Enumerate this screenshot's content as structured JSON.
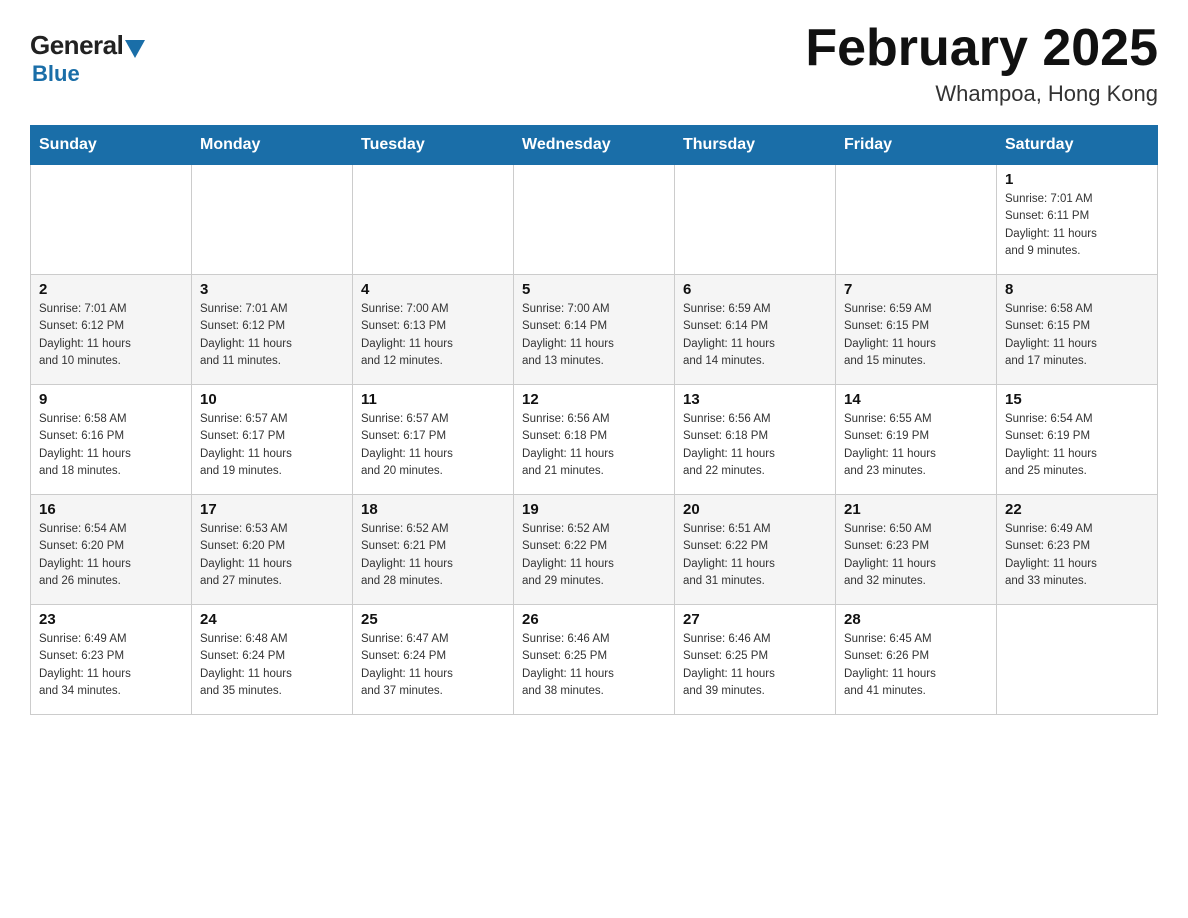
{
  "header": {
    "logo_general": "General",
    "logo_blue": "Blue",
    "month_title": "February 2025",
    "location": "Whampoa, Hong Kong"
  },
  "calendar": {
    "days": [
      "Sunday",
      "Monday",
      "Tuesday",
      "Wednesday",
      "Thursday",
      "Friday",
      "Saturday"
    ],
    "weeks": [
      [
        {
          "day": "",
          "info": ""
        },
        {
          "day": "",
          "info": ""
        },
        {
          "day": "",
          "info": ""
        },
        {
          "day": "",
          "info": ""
        },
        {
          "day": "",
          "info": ""
        },
        {
          "day": "",
          "info": ""
        },
        {
          "day": "1",
          "info": "Sunrise: 7:01 AM\nSunset: 6:11 PM\nDaylight: 11 hours\nand 9 minutes."
        }
      ],
      [
        {
          "day": "2",
          "info": "Sunrise: 7:01 AM\nSunset: 6:12 PM\nDaylight: 11 hours\nand 10 minutes."
        },
        {
          "day": "3",
          "info": "Sunrise: 7:01 AM\nSunset: 6:12 PM\nDaylight: 11 hours\nand 11 minutes."
        },
        {
          "day": "4",
          "info": "Sunrise: 7:00 AM\nSunset: 6:13 PM\nDaylight: 11 hours\nand 12 minutes."
        },
        {
          "day": "5",
          "info": "Sunrise: 7:00 AM\nSunset: 6:14 PM\nDaylight: 11 hours\nand 13 minutes."
        },
        {
          "day": "6",
          "info": "Sunrise: 6:59 AM\nSunset: 6:14 PM\nDaylight: 11 hours\nand 14 minutes."
        },
        {
          "day": "7",
          "info": "Sunrise: 6:59 AM\nSunset: 6:15 PM\nDaylight: 11 hours\nand 15 minutes."
        },
        {
          "day": "8",
          "info": "Sunrise: 6:58 AM\nSunset: 6:15 PM\nDaylight: 11 hours\nand 17 minutes."
        }
      ],
      [
        {
          "day": "9",
          "info": "Sunrise: 6:58 AM\nSunset: 6:16 PM\nDaylight: 11 hours\nand 18 minutes."
        },
        {
          "day": "10",
          "info": "Sunrise: 6:57 AM\nSunset: 6:17 PM\nDaylight: 11 hours\nand 19 minutes."
        },
        {
          "day": "11",
          "info": "Sunrise: 6:57 AM\nSunset: 6:17 PM\nDaylight: 11 hours\nand 20 minutes."
        },
        {
          "day": "12",
          "info": "Sunrise: 6:56 AM\nSunset: 6:18 PM\nDaylight: 11 hours\nand 21 minutes."
        },
        {
          "day": "13",
          "info": "Sunrise: 6:56 AM\nSunset: 6:18 PM\nDaylight: 11 hours\nand 22 minutes."
        },
        {
          "day": "14",
          "info": "Sunrise: 6:55 AM\nSunset: 6:19 PM\nDaylight: 11 hours\nand 23 minutes."
        },
        {
          "day": "15",
          "info": "Sunrise: 6:54 AM\nSunset: 6:19 PM\nDaylight: 11 hours\nand 25 minutes."
        }
      ],
      [
        {
          "day": "16",
          "info": "Sunrise: 6:54 AM\nSunset: 6:20 PM\nDaylight: 11 hours\nand 26 minutes."
        },
        {
          "day": "17",
          "info": "Sunrise: 6:53 AM\nSunset: 6:20 PM\nDaylight: 11 hours\nand 27 minutes."
        },
        {
          "day": "18",
          "info": "Sunrise: 6:52 AM\nSunset: 6:21 PM\nDaylight: 11 hours\nand 28 minutes."
        },
        {
          "day": "19",
          "info": "Sunrise: 6:52 AM\nSunset: 6:22 PM\nDaylight: 11 hours\nand 29 minutes."
        },
        {
          "day": "20",
          "info": "Sunrise: 6:51 AM\nSunset: 6:22 PM\nDaylight: 11 hours\nand 31 minutes."
        },
        {
          "day": "21",
          "info": "Sunrise: 6:50 AM\nSunset: 6:23 PM\nDaylight: 11 hours\nand 32 minutes."
        },
        {
          "day": "22",
          "info": "Sunrise: 6:49 AM\nSunset: 6:23 PM\nDaylight: 11 hours\nand 33 minutes."
        }
      ],
      [
        {
          "day": "23",
          "info": "Sunrise: 6:49 AM\nSunset: 6:23 PM\nDaylight: 11 hours\nand 34 minutes."
        },
        {
          "day": "24",
          "info": "Sunrise: 6:48 AM\nSunset: 6:24 PM\nDaylight: 11 hours\nand 35 minutes."
        },
        {
          "day": "25",
          "info": "Sunrise: 6:47 AM\nSunset: 6:24 PM\nDaylight: 11 hours\nand 37 minutes."
        },
        {
          "day": "26",
          "info": "Sunrise: 6:46 AM\nSunset: 6:25 PM\nDaylight: 11 hours\nand 38 minutes."
        },
        {
          "day": "27",
          "info": "Sunrise: 6:46 AM\nSunset: 6:25 PM\nDaylight: 11 hours\nand 39 minutes."
        },
        {
          "day": "28",
          "info": "Sunrise: 6:45 AM\nSunset: 6:26 PM\nDaylight: 11 hours\nand 41 minutes."
        },
        {
          "day": "",
          "info": ""
        }
      ]
    ]
  }
}
